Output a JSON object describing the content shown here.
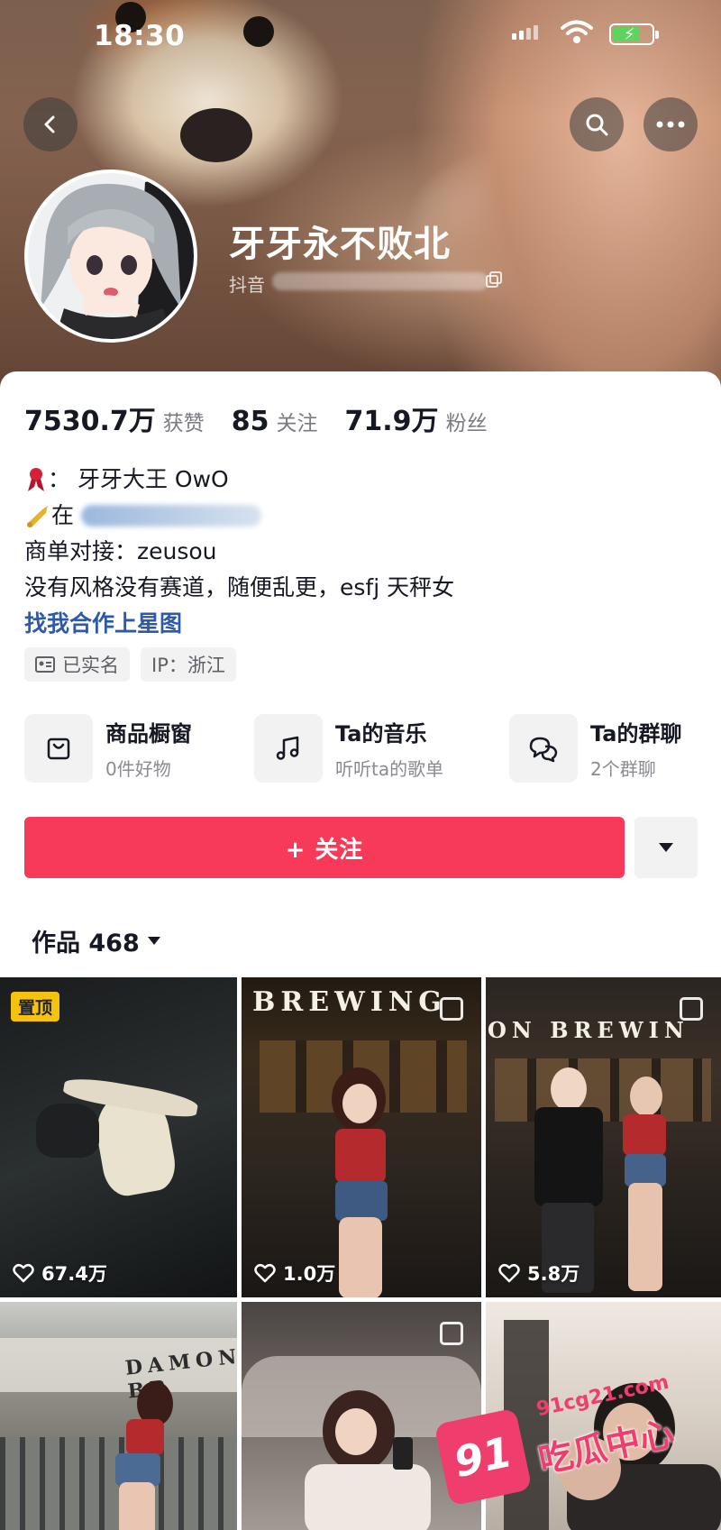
{
  "status_bar": {
    "time": "18:30"
  },
  "profile": {
    "name": "牙牙永不败北",
    "id_prefix": "抖音"
  },
  "stats": [
    {
      "value": "7530.7万",
      "label": "获赞"
    },
    {
      "value": "85",
      "label": "关注"
    },
    {
      "value": "71.9万",
      "label": "粉丝"
    }
  ],
  "bio": {
    "line1": "：  牙牙大王 OwO",
    "line2_prefix": "在",
    "line3": "商单对接：zeusou",
    "line4": "没有风格没有赛道，随便乱更，esfj 天秤女",
    "link": "找我合作上星图"
  },
  "tags": {
    "verified": "已实名",
    "ip": "IP：浙江"
  },
  "features": [
    {
      "title": "商品橱窗",
      "sub": "0件好物",
      "icon": "shopping-bag-icon"
    },
    {
      "title": "Ta的音乐",
      "sub": "听听ta的歌单",
      "icon": "music-note-icon"
    },
    {
      "title": "Ta的群聊",
      "sub": "2个群聊",
      "icon": "chat-bubbles-icon"
    }
  ],
  "actions": {
    "follow": "+ 关注"
  },
  "works": {
    "label": "作品 468"
  },
  "grid": {
    "pinned_label": "置顶",
    "items": [
      {
        "likes": "67.4万"
      },
      {
        "likes": "1.0万"
      },
      {
        "likes": "5.8万"
      }
    ],
    "signs": [
      "BREWING",
      "ON BREWIN",
      "DAMON BR"
    ]
  },
  "watermark": {
    "badge": "91",
    "url": "91cg21.com",
    "text": "吃瓜中心"
  },
  "colors": {
    "accent": "#f73a5a",
    "link": "#2d5aa8",
    "pin": "#f5c20f"
  }
}
